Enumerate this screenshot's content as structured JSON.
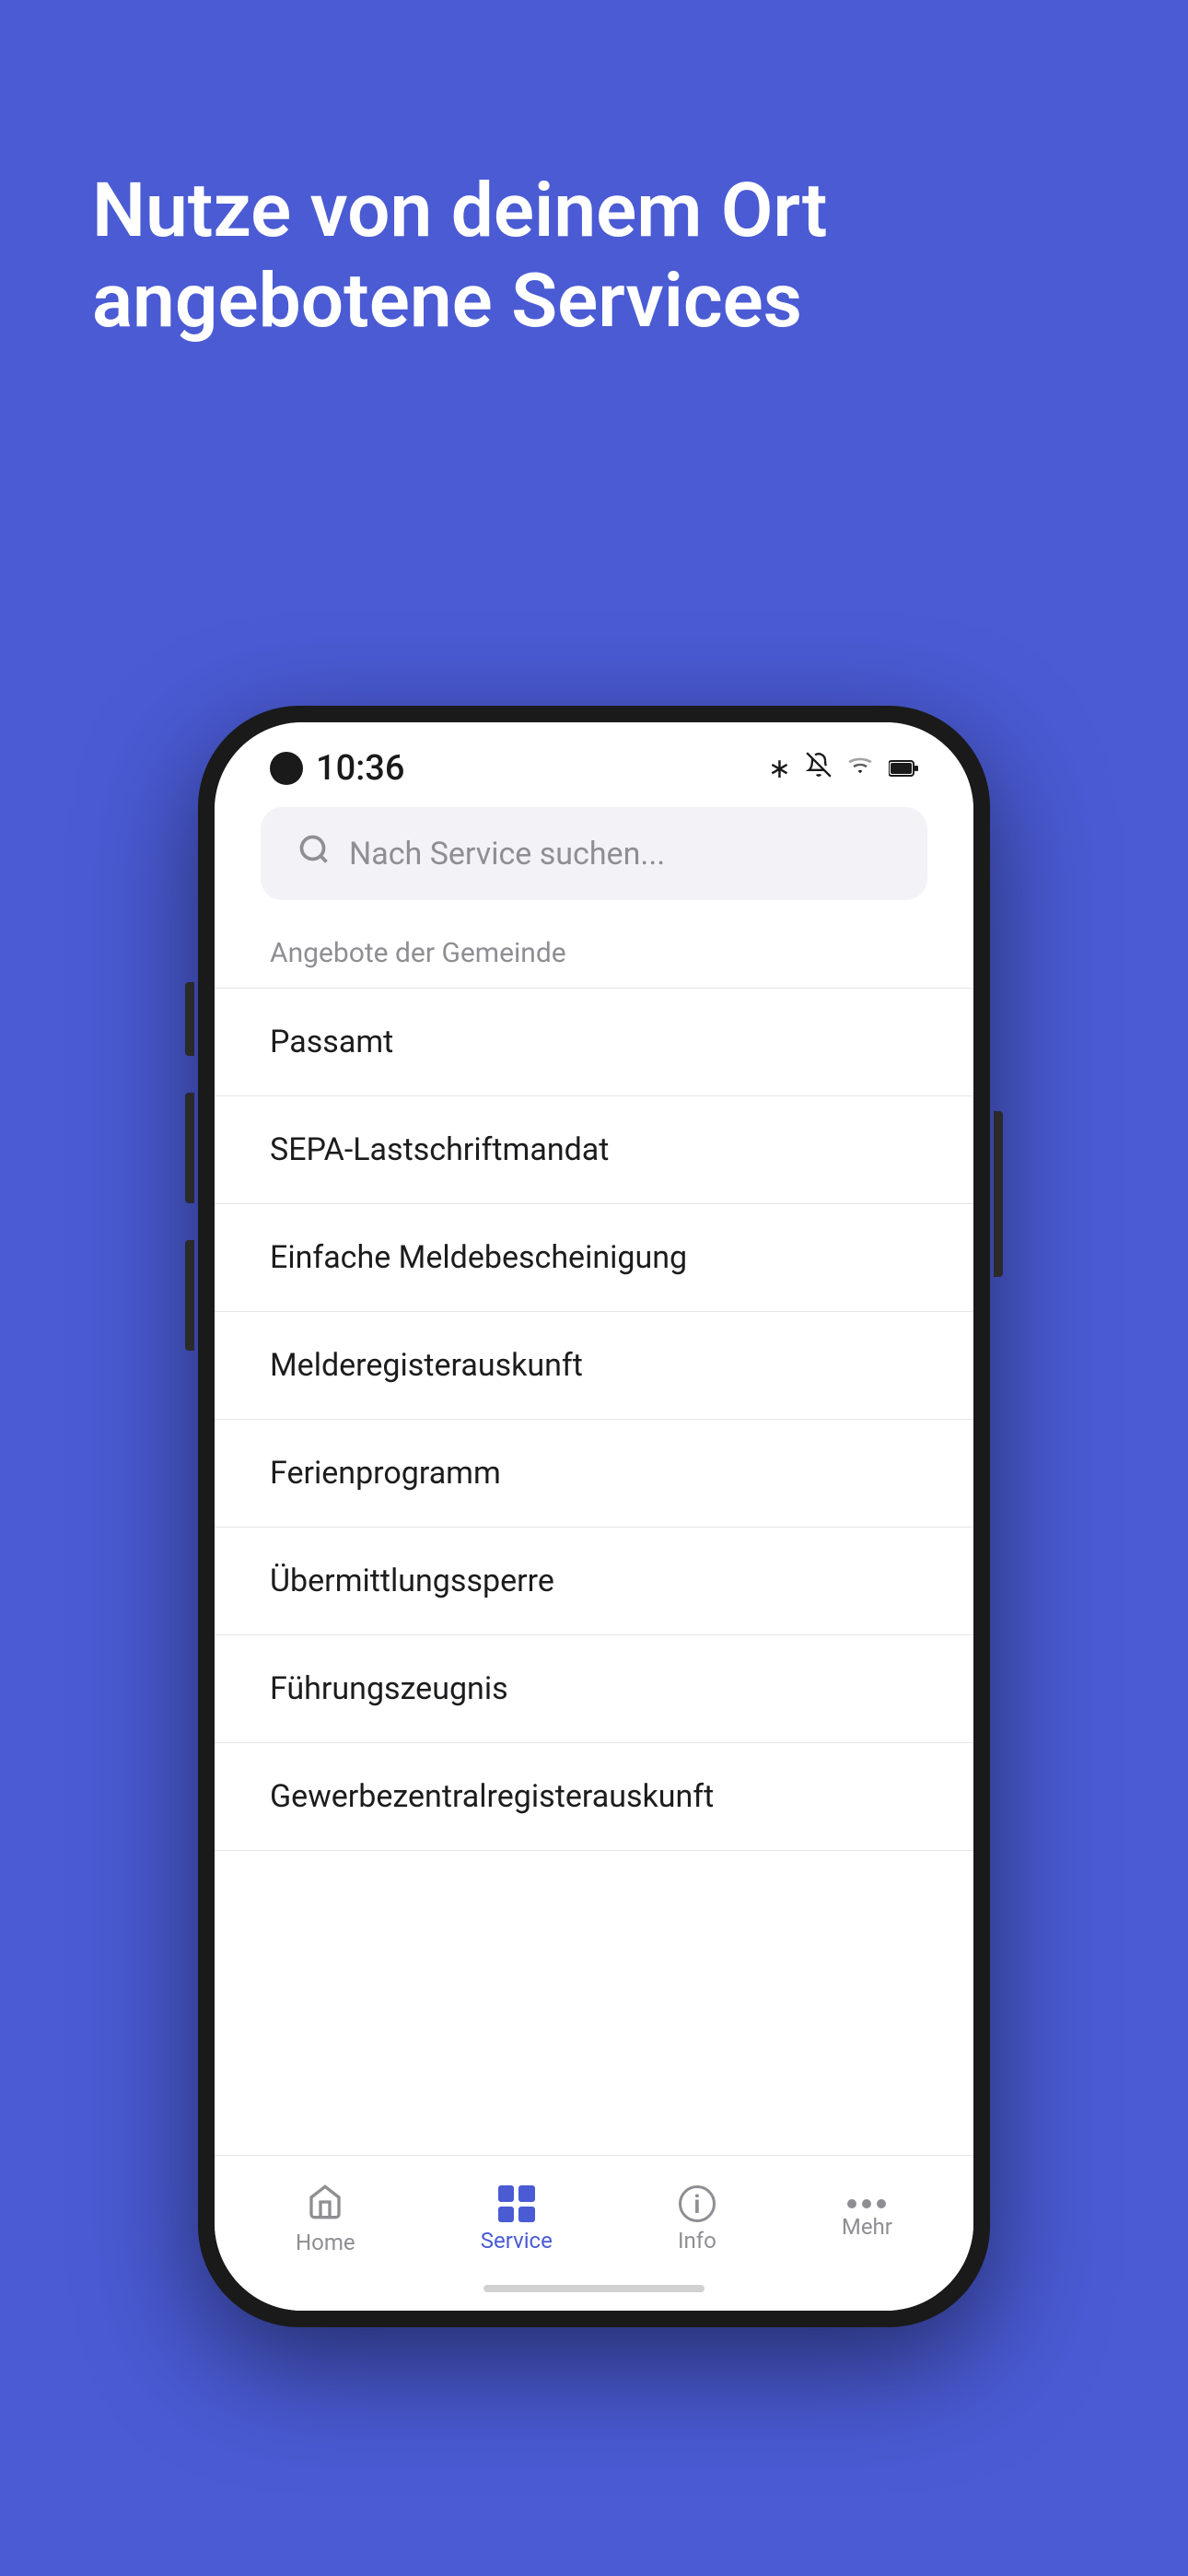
{
  "background_color": "#4A5BD4",
  "hero": {
    "title_line1": "Nutze von deinem Ort",
    "title_line2": "angebotene Services"
  },
  "phone": {
    "status_bar": {
      "time": "10:36",
      "icons": [
        "bluetooth",
        "bell-off",
        "wifi",
        "battery"
      ]
    },
    "search": {
      "placeholder": "Nach Service suchen..."
    },
    "section_title": "Angebote der Gemeinde",
    "list_items": [
      {
        "id": 1,
        "label": "Passamt"
      },
      {
        "id": 2,
        "label": "SEPA-Lastschriftmandat"
      },
      {
        "id": 3,
        "label": "Einfache Meldebescheinigung"
      },
      {
        "id": 4,
        "label": "Melderegisterauskunft"
      },
      {
        "id": 5,
        "label": "Ferienprogramm"
      },
      {
        "id": 6,
        "label": "Übermittlungssperre"
      },
      {
        "id": 7,
        "label": "Führungszeugnis"
      },
      {
        "id": 8,
        "label": "Gewerbezentralregisterauskunft"
      }
    ],
    "bottom_nav": {
      "items": [
        {
          "id": "home",
          "label": "Home",
          "active": false
        },
        {
          "id": "service",
          "label": "Service",
          "active": true
        },
        {
          "id": "info",
          "label": "Info",
          "active": false
        },
        {
          "id": "mehr",
          "label": "Mehr",
          "active": false
        }
      ]
    }
  }
}
